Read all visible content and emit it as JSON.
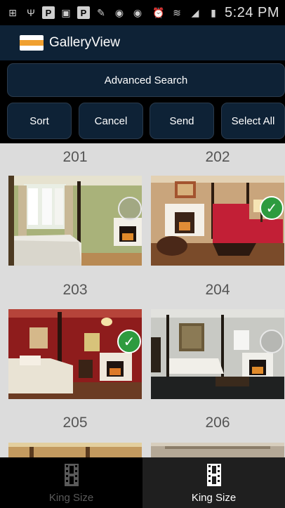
{
  "status_bar": {
    "time": "5:24 PM",
    "icons": [
      "add-icon",
      "usb-icon",
      "parking-icon",
      "image-icon",
      "parking-icon",
      "pen-icon",
      "app-icon",
      "app-icon",
      "alarm-icon",
      "wifi-icon",
      "signal-icon",
      "battery-icon"
    ]
  },
  "app_bar": {
    "title": "GalleryView"
  },
  "actions": {
    "advanced_search": "Advanced Search",
    "sort": "Sort",
    "cancel": "Cancel",
    "send": "Send",
    "select_all": "Select All"
  },
  "gallery": {
    "rooms": [
      {
        "label": "201",
        "selected": false
      },
      {
        "label": "202",
        "selected": true
      },
      {
        "label": "203",
        "selected": true
      },
      {
        "label": "204",
        "selected": false
      },
      {
        "label": "205",
        "selected": false
      },
      {
        "label": "206",
        "selected": false
      }
    ]
  },
  "tabs": [
    {
      "label": "King Size",
      "active": false
    },
    {
      "label": "King Size",
      "active": true
    }
  ],
  "colors": {
    "app_bar": "#0e2236",
    "gallery_bg": "#dcdcdc",
    "selected_check": "#2e9b3f"
  }
}
